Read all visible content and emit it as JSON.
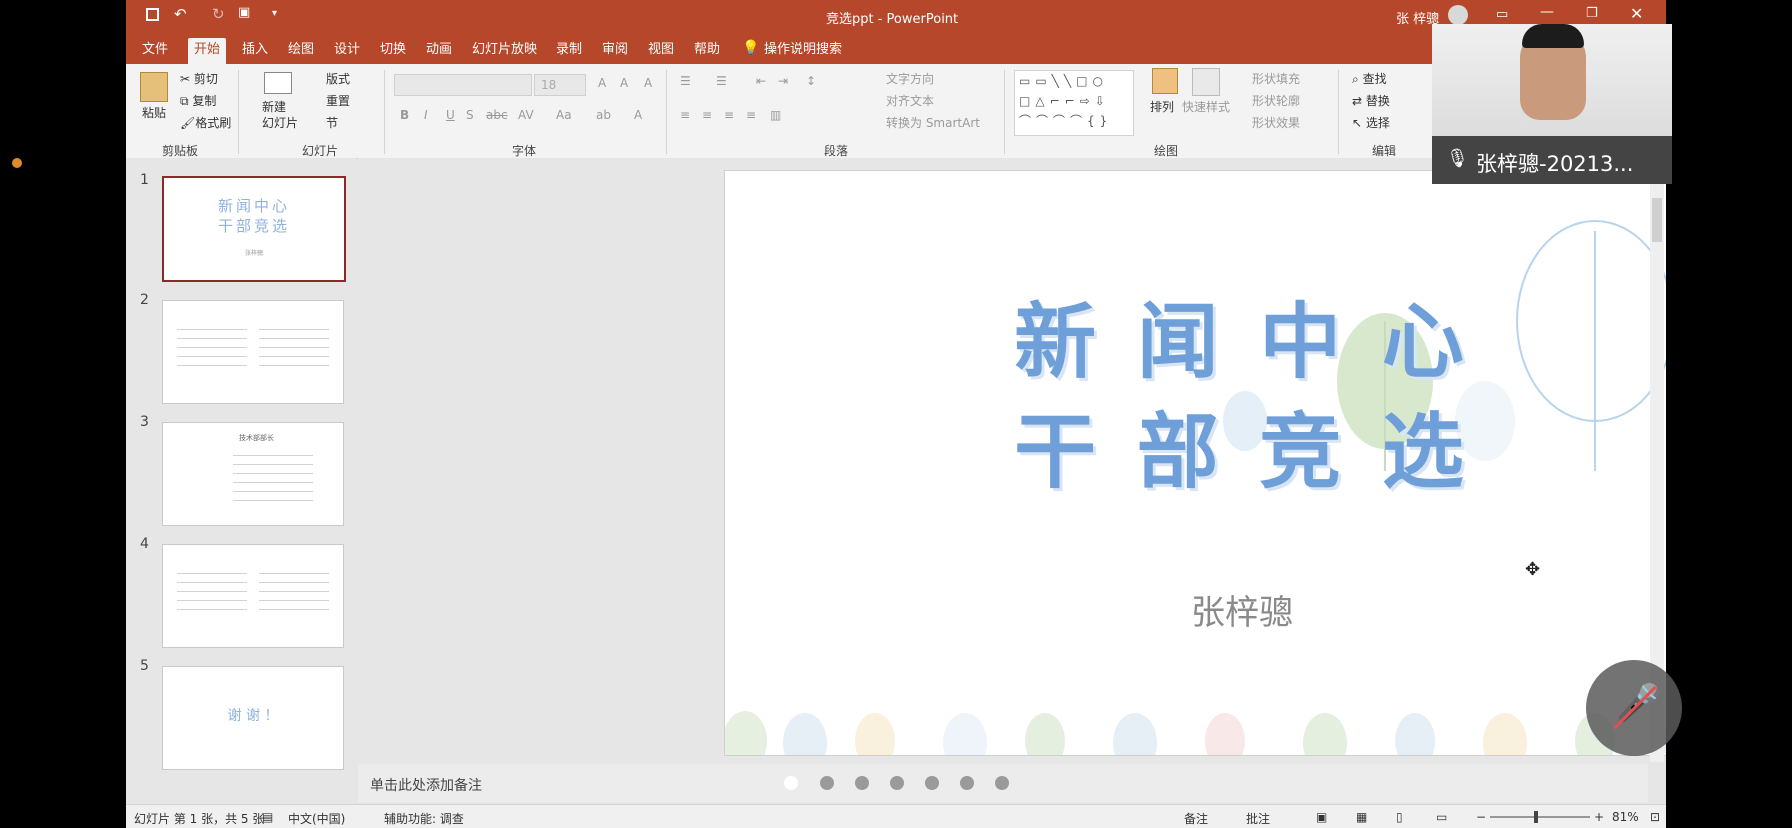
{
  "window": {
    "title": "竞选ppt  -  PowerPoint",
    "user": "张 梓骢"
  },
  "tabs": [
    "文件",
    "开始",
    "插入",
    "绘图",
    "设计",
    "切换",
    "动画",
    "幻灯片放映",
    "录制",
    "审阅",
    "视图",
    "帮助"
  ],
  "active_tab": "开始",
  "tell_me": "操作说明搜索",
  "ribbon": {
    "clipboard": {
      "label": "剪贴板",
      "paste": "粘贴",
      "cut": "剪切",
      "copy": "复制",
      "format_painter": "格式刷"
    },
    "slides": {
      "label": "幻灯片",
      "new_slide_1": "新建",
      "new_slide_2": "幻灯片",
      "layout": "版式",
      "reset": "重置",
      "section": "节"
    },
    "font": {
      "label": "字体",
      "font_size": "18",
      "change_case": "Aa"
    },
    "paragraph": {
      "label": "段落",
      "text_direction": "文字方向",
      "align_text": "对齐文本",
      "smartart": "转换为 SmartArt"
    },
    "drawing": {
      "label": "绘图",
      "arrange": "排列",
      "quick_styles": "快速样式",
      "shape_fill": "形状填充",
      "shape_outline": "形状轮廓",
      "shape_effects": "形状效果"
    },
    "editing": {
      "label": "编辑",
      "find": "查找",
      "replace": "替换",
      "select": "选择"
    }
  },
  "thumbnails": [
    {
      "num": "1",
      "line1": "新闻中心",
      "line2": "干部竞选",
      "sub": "张梓骢"
    },
    {
      "num": "2"
    },
    {
      "num": "3",
      "heading": "技术部部长"
    },
    {
      "num": "4"
    },
    {
      "num": "5",
      "text": "谢 谢 ！"
    }
  ],
  "slide": {
    "title_line1": "新 闻 中 心",
    "title_line2": "干 部 竞 选",
    "presenter": "张梓骢"
  },
  "notes_placeholder": "单击此处添加备注",
  "status": {
    "slide_info": "幻灯片 第 1 张，共 5 张",
    "language": "中文(中国)",
    "accessibility": "辅助功能: 调查",
    "notes": "备注",
    "comments": "批注",
    "zoom": "81%"
  },
  "video_overlay": {
    "name": "张梓骢-20213..."
  },
  "colors": {
    "accent": "#b7472a",
    "title_blue": "#6f9fd8",
    "selection": "#8b2a2a"
  }
}
